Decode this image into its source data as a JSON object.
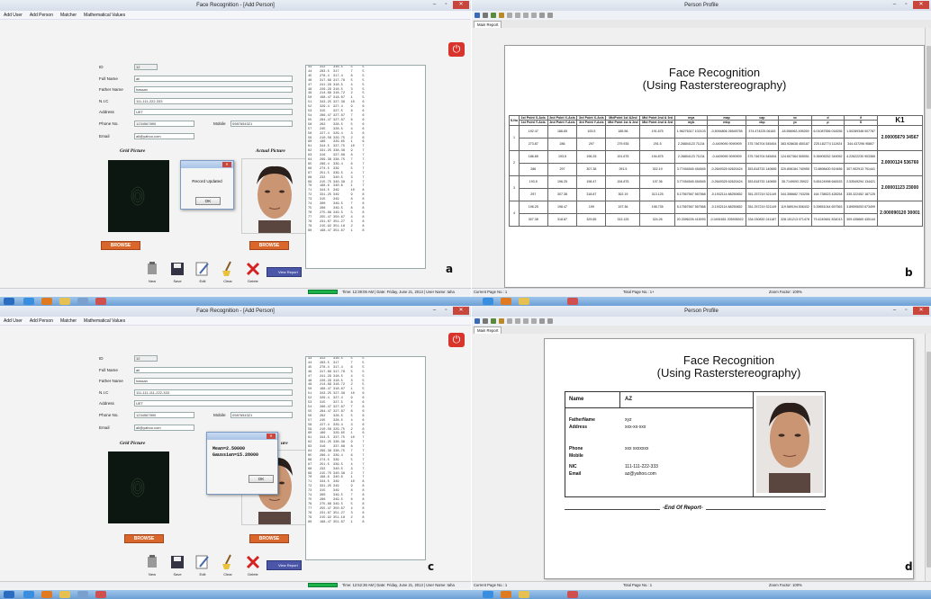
{
  "a": {
    "title": "Face Recognition - [Add Person]",
    "menu": [
      "Add User",
      "Add Person",
      "Matcher",
      "Mathematical Values"
    ],
    "form": {
      "id_label": "ID",
      "id_value": "12",
      "fullname_label": "Full Name",
      "fullname_value": "ali",
      "father_label": "Father Name",
      "father_value": "hassan",
      "nic_label": "N.I.C",
      "nic_value": "111-111-222-333",
      "address_label": "Address",
      "address_value": "UET",
      "phone_label": "Phone No.",
      "phone_value": "1234567890",
      "mobile_label": "Mobile",
      "mobile_value": "0987654321",
      "email_label": "Email",
      "email_value": "ali@yahoo.com"
    },
    "grid_label": "Grid Picture",
    "actual_label": "Actual Picture",
    "browse1": "BROWSE",
    "browse2": "BROWSE",
    "dialog_msg": "Record Updated",
    "dialog_ok": "OK",
    "tools": [
      "New",
      "Save",
      "Edit",
      "Clear",
      "Delete"
    ],
    "view_report": "View Report",
    "status": "Time: 12:39:06 AM  |  Date: Friday, June 21, 2013  |  User Name: taha",
    "letter": "a"
  },
  "b": {
    "title": "Person Profile",
    "tab": "Main Report",
    "report_title1": "Face Recognition",
    "report_title2": "(Using Rasterstereography)",
    "headers1": [
      "S.No",
      "1st Point X-Axis",
      "2nd Point X-Axis",
      "3rd Point X-Axis",
      "MidPoint 1st &2nd",
      "Mid Point 2nd & 3rd",
      "mya",
      "map",
      "cap",
      "xc",
      "d",
      "ϑ",
      "K1"
    ],
    "headers2": [
      "1st Point Y-Axis",
      "2nd Point Y-Axis",
      "3rd Point Y-Axis",
      "Mid Point 1st & 2nd",
      "Mid Point 2nd & 3rd",
      "myb",
      "mbp",
      "cbp",
      "yc",
      "ρ",
      "S"
    ],
    "rows": [
      {
        "n": "1",
        "r1": [
          "192.47",
          "186.65",
          "193.5",
          "185.56",
          "191.675",
          "1.96276317 102103",
          "-0.5094806 26545755",
          "374.474225 06183",
          "-18.556963 495269",
          "6.01087556 018255",
          "1.50289348 007787"
        ],
        "r2": [
          "273.87",
          "286",
          "297",
          "279.935",
          "291.5",
          "2.26804123 71134",
          "-0.4409090 9090909",
          "375.746704 545454",
          "383.928638 450187",
          "225.182774 111924",
          "344.437296 95807"
        ],
        "k1": "2.00005679 34567"
      },
      {
        "n": "2",
        "r1": [
          "186.65",
          "193.5",
          "196.25",
          "191.675",
          "194.875",
          "2.26804123 71134",
          "-0.4409090 9090909",
          "375.746704 545454",
          "124.607364 505051",
          "5.36905252 349052",
          "4.22622230 903365"
        ],
        "r2": [
          "286",
          "297",
          "307.38",
          "291.5",
          "302.19",
          "3.77454545 454545",
          "-0.2649325 62620424",
          "353.818733 140655",
          "320.806184 740955",
          "72.8898400 519456",
          "307.902913 791441"
        ],
        "k1": "2.0000124 536760"
      },
      {
        "n": "3",
        "r1": [
          "193.5",
          "196.25",
          "198.47",
          "194.875",
          "197.36",
          "3.77454545 454545",
          "-0.2649325 62620424",
          "353.818733 140655",
          "35.7149093 25922",
          "5.65124998 648153",
          "2.53549294 134421"
        ],
        "r2": [
          "297",
          "307.38",
          "318.87",
          "302.19",
          "313.125",
          "5.17567567 567568",
          "-0.1932114 88250652",
          "351.257219 321149",
          "344.356682 743206",
          "164.738523 428254",
          "335.322452 187125"
        ],
        "k1": "2.00001123 23000"
      },
      {
        "n": "4",
        "r1": [
          "196.25",
          "198.47",
          "199",
          "197.36",
          "198.735",
          "5.17567567 567568",
          "-0.1932114 88250652",
          "351.257219 321149",
          "119.589194 506432",
          "5.39651044 657563",
          "3.89595053 673499"
        ],
        "r2": [
          "307.38",
          "318.87",
          "329.65",
          "313.125",
          "324.26",
          "20.3396226 415093",
          "-0.0491651 205936922",
          "334.030830 241187",
          "328.151213 071478",
          "79.4249481 834013",
          "309.435669 435144"
        ],
        "k1": "2.000090120 30001"
      }
    ],
    "status_left": "Current Page No.: 1",
    "status_mid": "Total Page No.: 1+",
    "status_right": "Zoom Factor: 100%",
    "letter": "b"
  },
  "c": {
    "title": "Face Recognition - [Add Person]",
    "menu": [
      "Add User",
      "Add Person",
      "Matcher",
      "Mathematical Values"
    ],
    "form": {
      "id_label": "ID",
      "id_value": "12",
      "fullname_label": "Full Name",
      "fullname_value": "ali",
      "father_label": "Father Name",
      "father_value": "hassan",
      "nic_label": "N.I.C",
      "nic_value": "111-111-111-222-333",
      "address_label": "Address",
      "address_value": "UET",
      "phone_label": "Phone No.",
      "phone_value": "1234567890",
      "mobile_label": "Mobile",
      "mobile_value": "0987654321",
      "email_label": "Email",
      "email_value": "ali@yahoo.com"
    },
    "grid_label": "Grid Picture",
    "actual_label": "ure",
    "browse1": "BROWSE",
    "browse2": "BROWSE",
    "dialog_msg1": "Mean=2.50000",
    "dialog_msg2": "Gaussian=15.28000",
    "dialog_ok": "OK",
    "tools": [
      "New",
      "Save",
      "Edit",
      "Clear",
      "Delete"
    ],
    "view_report": "View Report",
    "status": "Time: 12:52:36 AM  |  Date: Friday, June 21, 2013  |  User Name: taha",
    "letter": "c"
  },
  "d": {
    "title": "Person Profile",
    "tab": "Main Report",
    "report_title1": "Face Recognition",
    "report_title2": "(Using Rasterstereography)",
    "name_label": "Name",
    "name_value": "AZ",
    "father_label": "FatherName",
    "father_value": "xyz",
    "address_label": "Address",
    "address_value": "xxx-xx-xxx",
    "phone_label": "Phone",
    "phone_value": "xxx xxxxxxx",
    "mobile_label": "Mobile",
    "mobile_value": "",
    "nic_label": "NIC",
    "nic_value": "111-111-222-333",
    "email_label": "Email",
    "email_value": "az@yahoo.com",
    "end": "-End Of Report-",
    "status_left": "Current Page No.: 1",
    "status_mid": "Total Page No.: 1",
    "status_right": "Zoom Factor: 100%",
    "letter": "d"
  },
  "list_rows": [
    "43    312    316.5    5     5",
    "44    283.5  317      7     5",
    "45    278.4  317.4    6     5",
    "46    317.89 317.78   5     5",
    "47    241.29 318.5    4     5",
    "48    226.29 318.5    3     5",
    "49    214.89 318.72   2     5",
    "50    198.47 318.87   1     5",
    "51    343.25 327.38   10    6",
    "52    329.4  327.4    9     6",
    "53    315    327.5    8     6",
    "54    286.47 327.87   7     6",
    "55    284.47 327.87   6     6",
    "56    262    328.5    5     6",
    "57    245    328.5    4     6",
    "58    227.4  329.4    3     6",
    "59    210.56 329.75   2     6",
    "60    186    329.65   1     6",
    "61    344.5  337.75   10    7",
    "62    331.25 338.38   9     7",
    "63    316    337.88   8     7",
    "64    299.38 338.75   7     7",
    "65    286.4  339.4    6     7",
    "66    274.5  339      5     7",
    "67    251.5  339.5    4     7",
    "68    232    340.5    3     7",
    "69    215.75 340.38   2     7",
    "70    198.6  340.6    1     7",
    "71    344.5  349      10    8",
    "72    331.25 349      9     8",
    "73    315    349      8     8",
    "74    300    349.5    7     8",
    "75    286    349.5    6     8",
    "76    275.88 349.5    5     8",
    "77    255.47 350.67   4     8",
    "78    231.67 351.27   3     8",
    "79    215.92 351.18   2     8",
    "80    198.47 351.87   1     8"
  ]
}
